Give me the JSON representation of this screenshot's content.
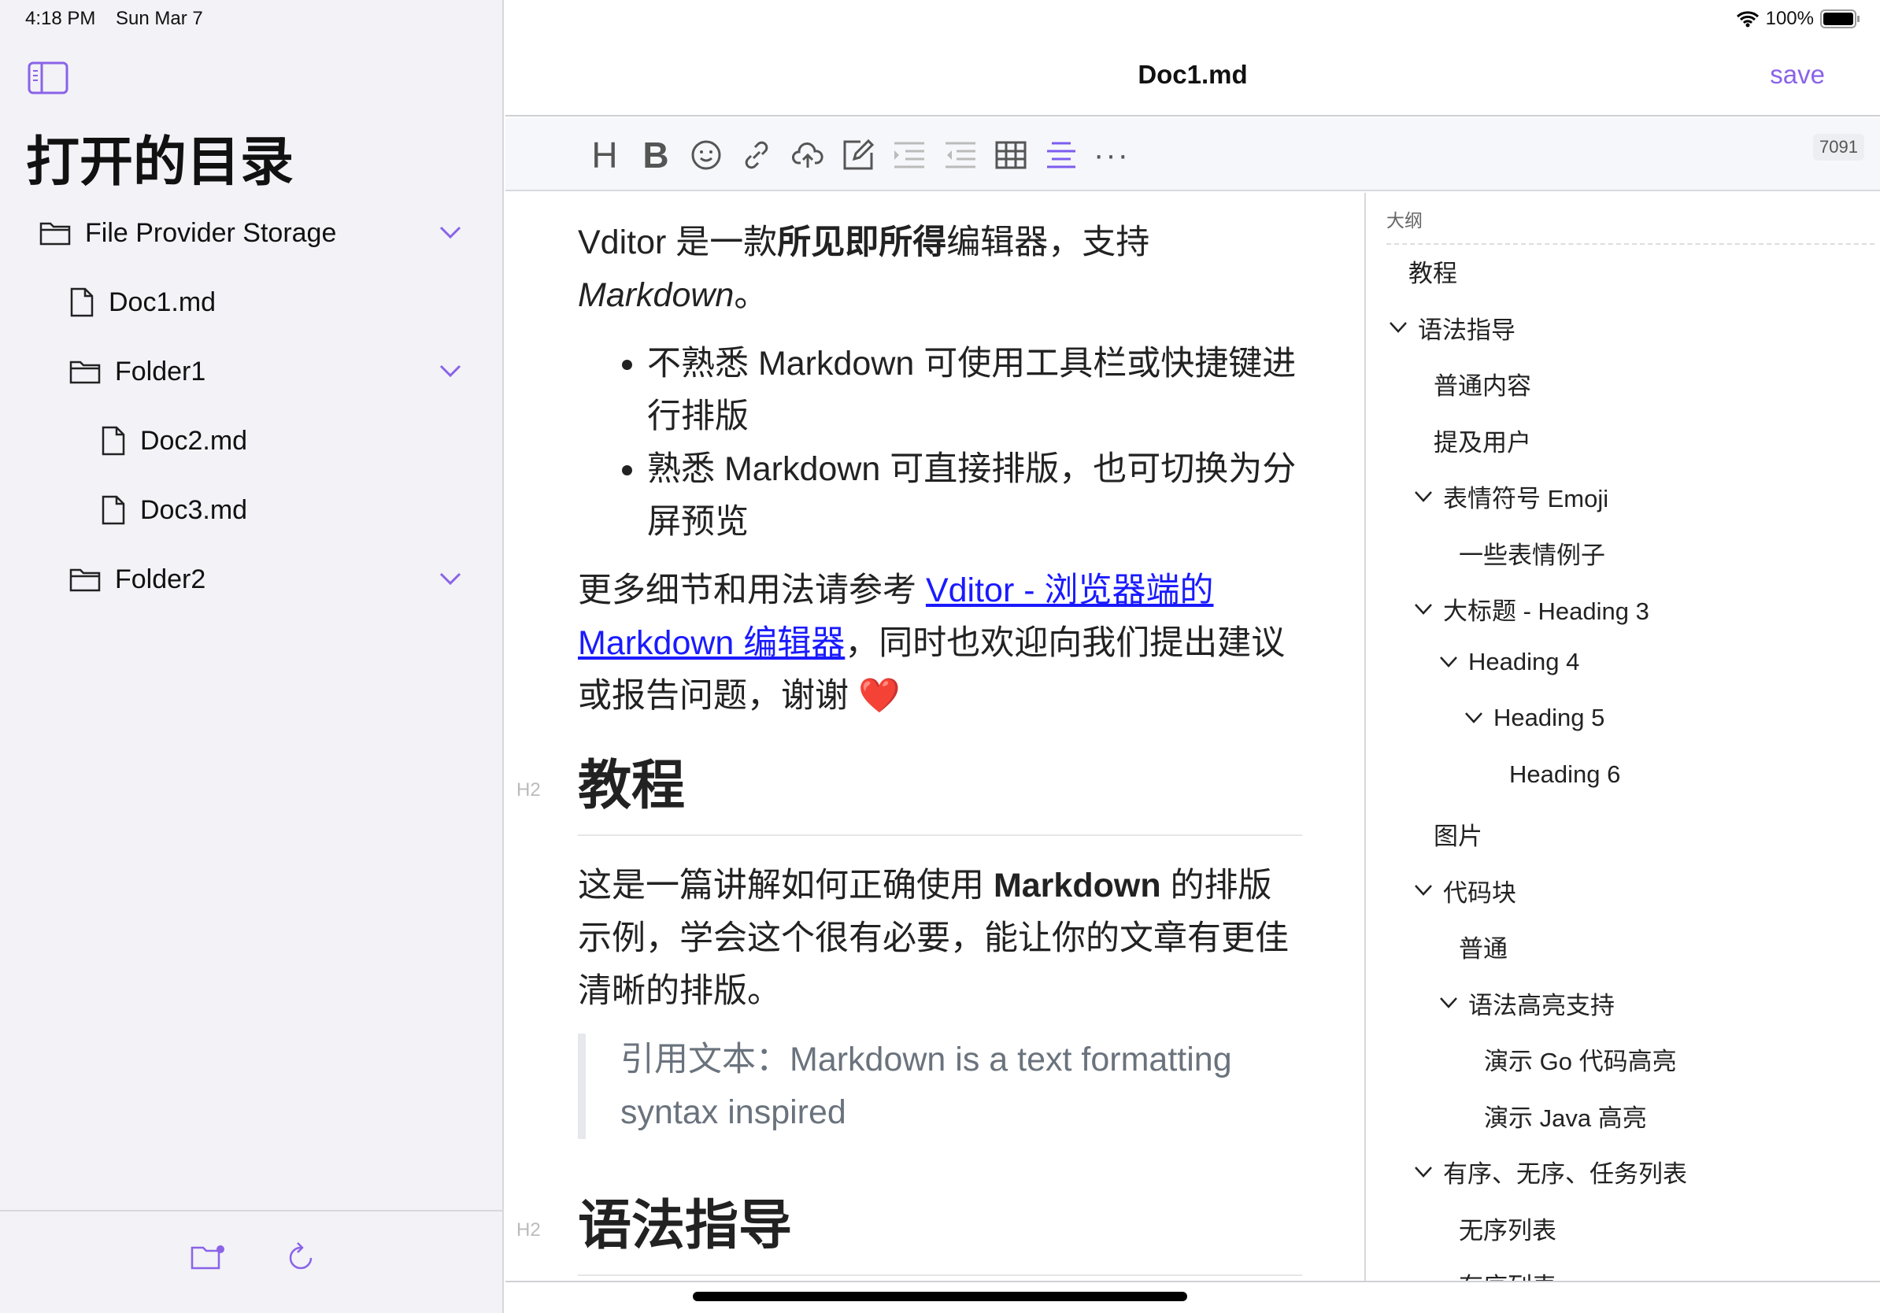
{
  "status": {
    "time": "4:18 PM",
    "date": "Sun Mar 7",
    "battery": "100%"
  },
  "sidebar": {
    "title": "打开的目录",
    "items": [
      {
        "label": "File Provider Storage",
        "type": "folder"
      },
      {
        "label": "Doc1.md",
        "type": "file"
      },
      {
        "label": "Folder1",
        "type": "folder"
      },
      {
        "label": "Doc2.md",
        "type": "file"
      },
      {
        "label": "Doc3.md",
        "type": "file"
      },
      {
        "label": "Folder2",
        "type": "folder"
      }
    ]
  },
  "header": {
    "title": "Doc1.md",
    "save_label": "save"
  },
  "toolbar": {
    "count": "7091",
    "accent": "#7b5cf0"
  },
  "editor": {
    "p1_a": "Vditor 是一款",
    "p1_b": "所见即所得",
    "p1_c": "编辑器，支持 ",
    "p1_d": "Markdown",
    "p1_e": "。",
    "li1": "不熟悉 Markdown 可使用工具栏或快捷键进行排版",
    "li2": "熟悉 Markdown 可直接排版，也可切换为分屏预览",
    "p2_a": "更多细节和用法请参考 ",
    "p2_link": "Vditor - 浏览器端的 Markdown 编辑器",
    "p2_b": "，同时也欢迎向我们提出建议或报告问题，谢谢 ",
    "heart": "❤️",
    "h2_tag": "H2",
    "h2": "教程",
    "p3_a": "这是一篇讲解如何正确使用 ",
    "p3_b": "Markdown",
    "p3_c": " 的排版示例，学会这个很有必要，能让你的文章有更佳清晰的排版。",
    "quote": "引用文本：Markdown is a text formatting syntax inspired",
    "h2b_tag": "H2",
    "h2b": "语法指导"
  },
  "outline": {
    "title": "大纲",
    "items": [
      {
        "label": "教程",
        "level": 0,
        "chevron": false
      },
      {
        "label": "语法指导",
        "level": 0,
        "chevron": true
      },
      {
        "label": "普通内容",
        "level": 1,
        "chevron": false
      },
      {
        "label": "提及用户",
        "level": 1,
        "chevron": false
      },
      {
        "label": "表情符号 Emoji",
        "level": 1,
        "chevron": true
      },
      {
        "label": "一些表情例子",
        "level": 2,
        "chevron": false
      },
      {
        "label": "大标题 - Heading 3",
        "level": 1,
        "chevron": true
      },
      {
        "label": "Heading 4",
        "level": 2,
        "chevron": true
      },
      {
        "label": "Heading 5",
        "level": 3,
        "chevron": true
      },
      {
        "label": "Heading 6",
        "level": 4,
        "chevron": false
      },
      {
        "label": "图片",
        "level": 1,
        "chevron": false
      },
      {
        "label": "代码块",
        "level": 1,
        "chevron": true
      },
      {
        "label": "普通",
        "level": 2,
        "chevron": false
      },
      {
        "label": "语法高亮支持",
        "level": 2,
        "chevron": true
      },
      {
        "label": "演示 Go 代码高亮",
        "level": 3,
        "chevron": false
      },
      {
        "label": "演示 Java 高亮",
        "level": 3,
        "chevron": false
      },
      {
        "label": "有序、无序、任务列表",
        "level": 1,
        "chevron": true
      },
      {
        "label": "无序列表",
        "level": 2,
        "chevron": false
      },
      {
        "label": "有序列表",
        "level": 2,
        "chevron": false
      }
    ]
  }
}
